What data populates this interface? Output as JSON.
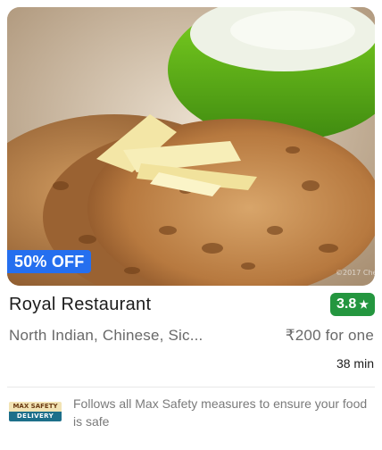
{
  "restaurant": {
    "discount": "50% OFF",
    "name": "Royal Restaurant",
    "rating": "3.8",
    "rating_color": "#24963f",
    "cuisines": "North Indian, Chinese, Sic...",
    "price": "₹200 for one",
    "delivery_time": "38 min",
    "image_icon": "food-photo"
  },
  "safety": {
    "badge_top": "MAX SAFETY",
    "badge_bottom": "DELIVERY",
    "text": "Follows all Max Safety measures to ensure your food is safe"
  },
  "colors": {
    "discount_bg": "#256fef",
    "badge_teal": "#1d6f8a"
  }
}
